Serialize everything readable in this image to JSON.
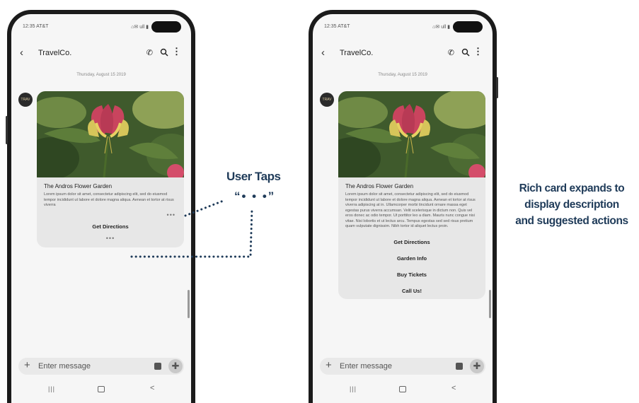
{
  "annotation": {
    "tap_label": "User Taps",
    "tap_dots": "“• • •”",
    "caption_lines": [
      "Rich card expands to",
      "display description",
      "and suggested actions"
    ]
  },
  "phones": [
    {
      "status": {
        "time": "12:35 AT&T",
        "icons": "⌂✉ ull ▮"
      },
      "contact_name": "TravelCo.",
      "date_label": "Thursday, August 15 2019",
      "avatar_text": "TRAV",
      "card": {
        "title": "The Andros Flower Garden",
        "description": "Lorem ipsum dolor sit amet, consectetur adipiscing elit, sed do eiusmod tempor incididunt ut labore et dolore magna aliqua. Aenean et tortor at risus viverra",
        "more_label": "•••",
        "actions": [
          "Get Directions"
        ],
        "bottom_more": "•••"
      },
      "composer": {
        "placeholder": "Enter message"
      },
      "nav": {
        "recents": "|||",
        "back": "<"
      }
    },
    {
      "status": {
        "time": "12:35 AT&T",
        "icons": "⌂✉ ull ▮"
      },
      "contact_name": "TravelCo.",
      "date_label": "Thursday, August 15 2019",
      "avatar_text": "TRAV",
      "card": {
        "title": "The Andros Flower Garden",
        "description": "Lorem ipsum dolor sit amet, consectetur adipiscing elit, sed do eiusmod tempor incididunt ut labore et dolore magna aliqua. Aenean et tortor at risus viverra adipiscing at in. Ullamcorper morbi tincidunt ornare massa eget egestas purus viverra accumsan. Velit scelerisque in dictum non. Quis vel eros donec ac odio tempor. Ut porttitor leo a diam. Mauris nunc congue nisi vitae. Nisi lobortis et ut lectus arcu. Tempus egestas sed sed risus pretium quam vulputate dignissim. Nibh tortor id aliquet lectus proin.",
        "actions": [
          "Get Directions",
          "Garden Info",
          "Buy Tickets",
          "Call Us!"
        ]
      },
      "composer": {
        "placeholder": "Enter message"
      },
      "nav": {
        "recents": "|||",
        "back": "<"
      }
    }
  ]
}
